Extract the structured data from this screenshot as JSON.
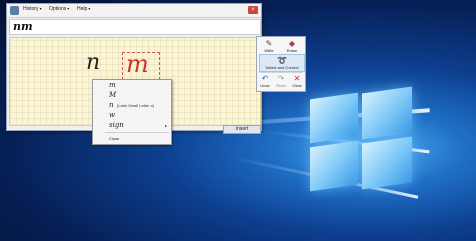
{
  "menubar": {
    "items": [
      {
        "label": "History",
        "chevron": "▾"
      },
      {
        "label": "Options",
        "chevron": "▾"
      },
      {
        "label": "Help",
        "chevron": "▾"
      }
    ],
    "close_glyph": "×"
  },
  "recognized_text": "nm",
  "pad": {
    "ink_n": "n",
    "ink_m": "m",
    "insert_label": "Insert"
  },
  "toolpanel": {
    "write": {
      "label": "Write",
      "icon": "pen-icon"
    },
    "erase": {
      "label": "Erase",
      "icon": "eraser-icon"
    },
    "select_correct": {
      "label": "Select and Correct",
      "icon": "lasso-icon"
    },
    "undo": {
      "label": "Undo",
      "icon": "undo-icon"
    },
    "redo": {
      "label": "Redo",
      "icon": "redo-icon"
    },
    "clear": {
      "label": "Clear",
      "icon": "clear-icon"
    }
  },
  "context_menu": {
    "items": [
      {
        "glyph": "m",
        "desc": ""
      },
      {
        "glyph": "M",
        "desc": ""
      },
      {
        "glyph": "n",
        "desc": "(Latin Small Letter n)"
      },
      {
        "glyph": "w",
        "desc": ""
      },
      {
        "glyph": "sign",
        "desc": "",
        "submenu": "▸"
      }
    ],
    "close_label": "Close"
  },
  "colors": {
    "accent_red": "#d0312d",
    "pad_bg": "#fbf5d6",
    "desktop_blue": "#0d3f8f"
  }
}
